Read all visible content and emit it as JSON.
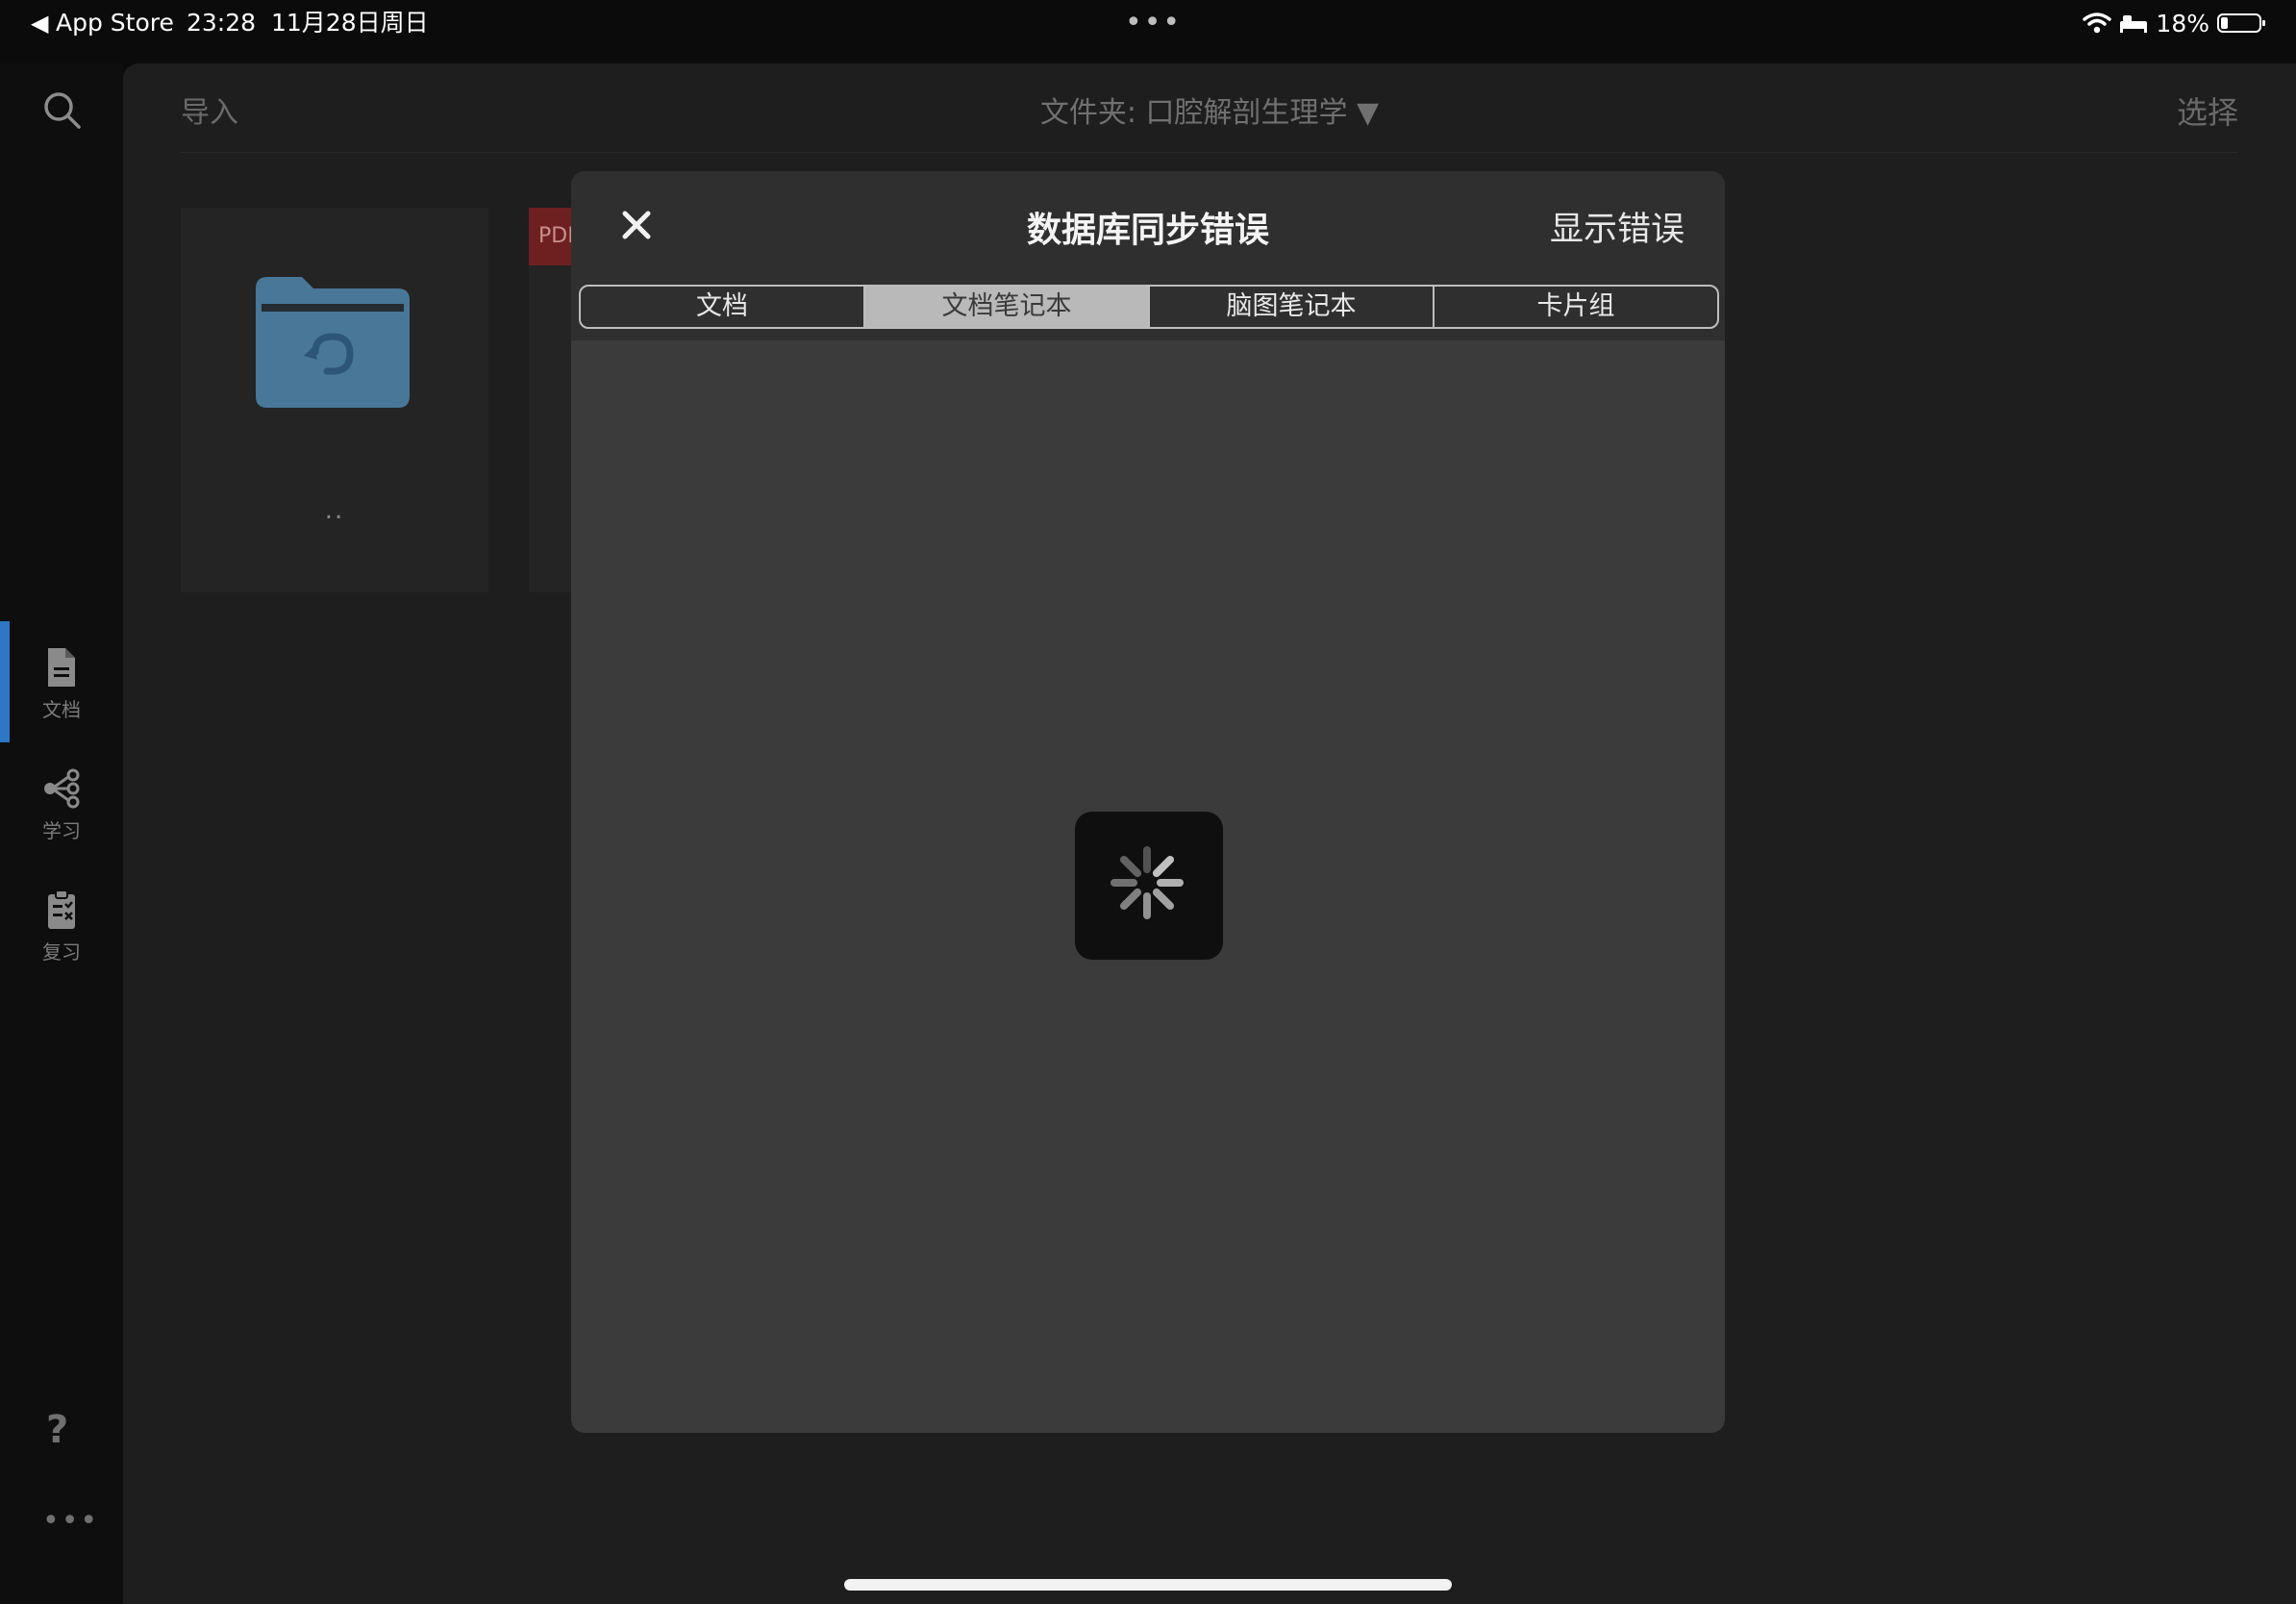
{
  "status_bar": {
    "back_arrow": "◀",
    "back_app": "App Store",
    "time": "23:28",
    "date": "11月28日周日",
    "center_dots": "•••",
    "battery_percent": "18%",
    "battery_level": 0.18,
    "icons": [
      "wifi-icon",
      "bed-icon",
      "battery-icon"
    ]
  },
  "sidebar": {
    "search_icon": "search-icon",
    "items": [
      {
        "label": "文档",
        "icon": "document-icon",
        "active": true
      },
      {
        "label": "学习",
        "icon": "share-nodes-icon",
        "active": false
      },
      {
        "label": "复习",
        "icon": "clipboard-check-icon",
        "active": false
      }
    ],
    "help": "?",
    "more": "•••"
  },
  "header": {
    "import": "导入",
    "folder_title": "文件夹: 口腔解剖生理学 ▼",
    "select": "选择"
  },
  "files": {
    "parent_folder_label": "..",
    "pdf_badge": "PDF"
  },
  "modal": {
    "close_icon": "close-icon",
    "title": "数据库同步错误",
    "show_errors": "显示错误",
    "tabs": [
      {
        "label": "文档",
        "selected": false
      },
      {
        "label": "文档笔记本",
        "selected": true
      },
      {
        "label": "脑图笔记本",
        "selected": false
      },
      {
        "label": "卡片组",
        "selected": false
      }
    ],
    "spinner_icon": "loading-spinner-icon"
  },
  "colors": {
    "accent": "#2e77c7",
    "folder": "#4f86ad",
    "pdf": "#6e2020"
  }
}
